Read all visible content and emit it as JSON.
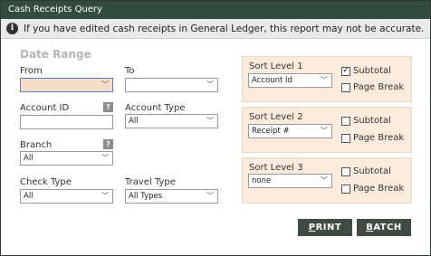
{
  "window": {
    "title": "Cash Receipts Query"
  },
  "info": {
    "text": "If you have edited cash receipts in General Ledger, this report may not be accurate."
  },
  "date_range": {
    "title": "Date Range",
    "from_label": "From",
    "from_value": "",
    "to_label": "To",
    "to_value": ""
  },
  "account_id": {
    "label": "Account ID",
    "value": ""
  },
  "account_type": {
    "label": "Account Type",
    "value": "All"
  },
  "branch": {
    "label": "Branch",
    "value": "All"
  },
  "check_type": {
    "label": "Check Type",
    "value": "All"
  },
  "travel_type": {
    "label": "Travel Type",
    "value": "All Types"
  },
  "sort_levels": [
    {
      "label": "Sort Level 1",
      "value": "Account Id",
      "subtotal_label": "Subtotal",
      "subtotal_checked": true,
      "page_break_label": "Page Break",
      "page_break_checked": false
    },
    {
      "label": "Sort Level 2",
      "value": "Receipt #",
      "subtotal_label": "Subtotal",
      "subtotal_checked": false,
      "page_break_label": "Page Break",
      "page_break_checked": false
    },
    {
      "label": "Sort Level 3",
      "value": "none",
      "subtotal_label": "Subtotal",
      "subtotal_checked": false,
      "page_break_label": "Page Break",
      "page_break_checked": false
    }
  ],
  "buttons": {
    "print_first": "P",
    "print_rest": "RINT",
    "batch_first": "B",
    "batch_rest": "ATCH"
  },
  "icons": {
    "info": "info-icon",
    "help": "help-icon",
    "dropdown": "chevron-down-icon",
    "check": "checkmark-icon"
  },
  "colors": {
    "titlebar": "#334c40",
    "highlight_field": "#f5dcc4",
    "sort_panel": "#fbebdd",
    "button": "#3e4c44"
  }
}
